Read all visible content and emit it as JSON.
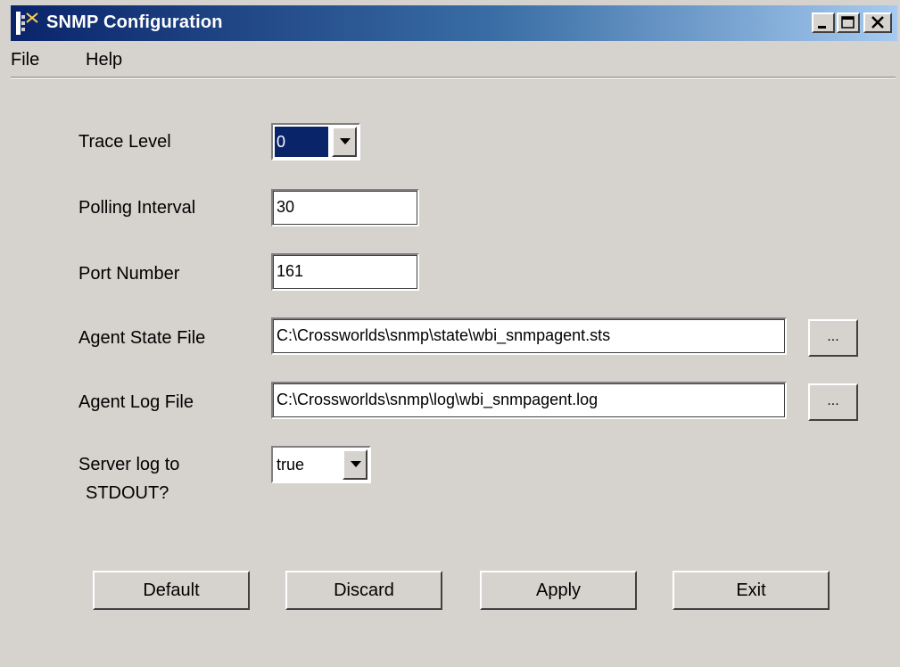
{
  "window": {
    "title": "SNMP Configuration",
    "controls": {
      "minimize": "minimize",
      "maximize": "maximize",
      "close": "close"
    }
  },
  "menu": {
    "file": "File",
    "help": "Help"
  },
  "form": {
    "trace_level": {
      "label": "Trace Level",
      "value": "0"
    },
    "polling_interval": {
      "label": "Polling Interval",
      "value": "30"
    },
    "port_number": {
      "label": "Port Number",
      "value": "161"
    },
    "agent_state_file": {
      "label": "Agent State File",
      "value": "C:\\Crossworlds\\snmp\\state\\wbi_snmpagent.sts",
      "browse": "..."
    },
    "agent_log_file": {
      "label": "Agent Log File",
      "value": "C:\\Crossworlds\\snmp\\log\\wbi_snmpagent.log",
      "browse": "..."
    },
    "server_log": {
      "label_line1": "Server log to",
      "label_line2": "STDOUT?",
      "value": "true"
    }
  },
  "buttons": {
    "default": "Default",
    "discard": "Discard",
    "apply": "Apply",
    "exit": "Exit"
  },
  "icons": {
    "app": "tree-app-icon",
    "dropdown": "chevron-down-icon"
  }
}
